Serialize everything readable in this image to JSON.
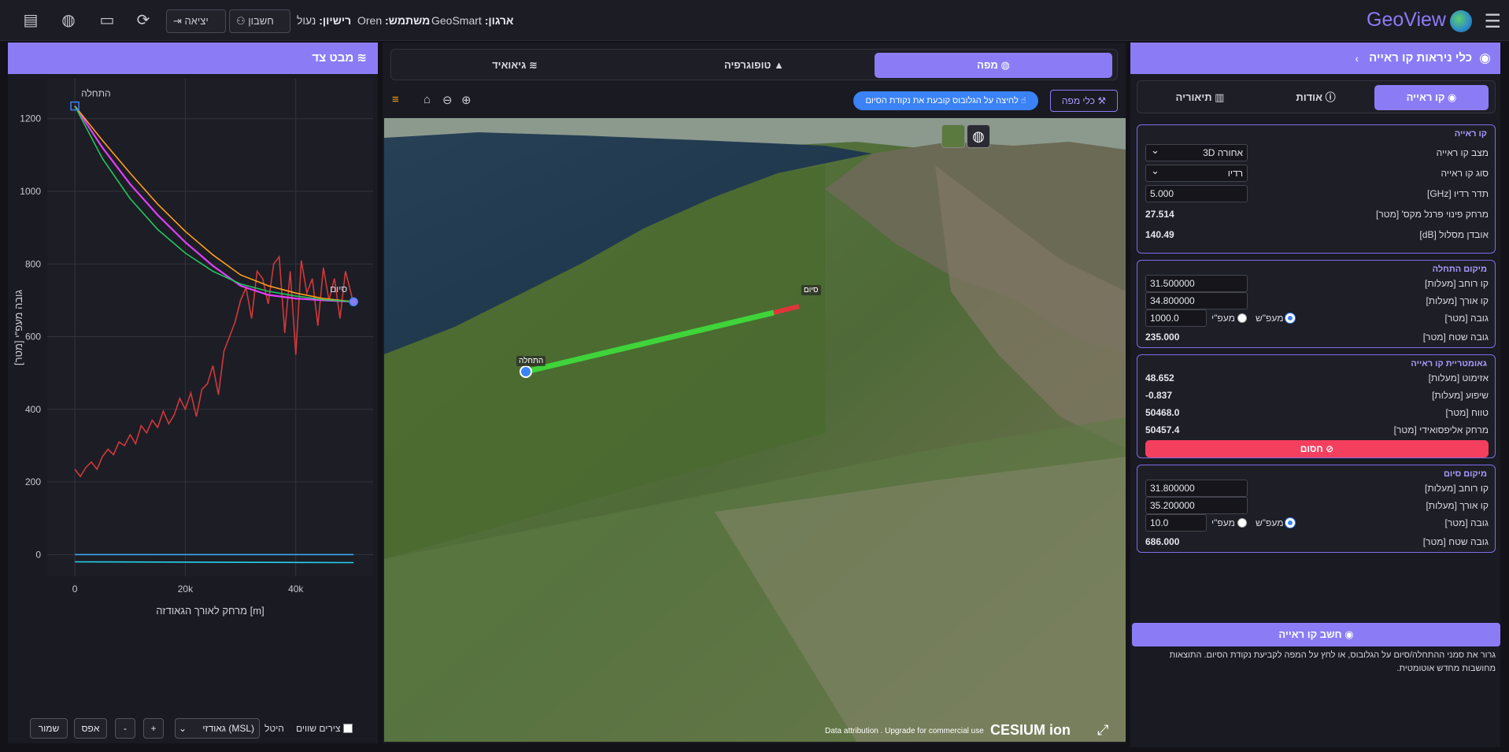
{
  "header": {
    "app_name": "GeoView",
    "org_label": "ארגון:",
    "org_value": "GeoSmart",
    "user_label": "משתמש:",
    "user_value": "Oren",
    "license_label": "רישיון:",
    "license_value": "נעול",
    "account_button": "חשבון",
    "logout_button": "יציאה",
    "icons": [
      "menu-icon",
      "globe-logo-icon",
      "chat-icon",
      "language-icon",
      "monitor-icon",
      "sync-icon",
      "account-icon",
      "logout-icon"
    ]
  },
  "right_panel": {
    "title": "כלי ניראות קו ראייה",
    "tabs": [
      {
        "label": "קו ראייה",
        "active": true
      },
      {
        "label": "אודות",
        "active": false
      },
      {
        "label": "תיאוריה",
        "active": false
      }
    ],
    "los": {
      "title": "קו ראייה",
      "mode_label": "מצב קו ראייה",
      "mode_value": "אחורה 3D",
      "type_label": "סוג קו ראייה",
      "type_value": "רדיו",
      "freq_label": "תדר רדיו [GHz]",
      "freq_value": "5.000",
      "fresnel_label": "מרחק פינוי פרנל מקס' [מטר]",
      "fresnel_value": "27.514",
      "loss_label": "אובדן מסלול [dB]",
      "loss_value": "140.49"
    },
    "start": {
      "title": "מיקום התחלה",
      "lat_label": "קו רוחב [מעלות]",
      "lat_value": "31.500000",
      "lon_label": "קו אורך [מעלות]",
      "lon_value": "34.800000",
      "height_label": "גובה [מטר]",
      "height_value": "1000.0",
      "radio_ground": "מעפ\"י",
      "radio_msl": "מעפ\"ש",
      "terrain_label": "גובה שטח [מטר]",
      "terrain_value": "235.000"
    },
    "geometry": {
      "title": "גאומטריית קו ראייה",
      "azimuth_label": "אזימוט [מעלות]",
      "azimuth_value": "48.652",
      "slope_label": "שיפוע [מעלות]",
      "slope_value": "-0.837",
      "range_label": "טווח [מטר]",
      "range_value": "50468.0",
      "ellipsoid_label": "מרחק אליפסואידי [מטר]",
      "ellipsoid_value": "50457.4",
      "blocked_button": "חסום"
    },
    "end": {
      "title": "מיקום סיום",
      "lat_label": "קו רוחב [מעלות]",
      "lat_value": "31.800000",
      "lon_label": "קו אורך [מעלות]",
      "lon_value": "35.200000",
      "height_label": "גובה [מטר]",
      "height_value": "10.0",
      "radio_ground": "מעפ\"י",
      "radio_msl": "מעפ\"ש",
      "terrain_label": "גובה שטח [מטר]",
      "terrain_value": "686.000"
    },
    "calc_button": "חשב קו ראייה",
    "note": "גרור את סמני ההתחלה/סיום על הגלובוס, או לחץ על המפה לקביעת נקודת הסיום. התוצאות מחושבות מחדש אוטומטית."
  },
  "center": {
    "tabs": [
      {
        "label": "מפה",
        "active": true
      },
      {
        "label": "טופוגרפיה",
        "active": false
      },
      {
        "label": "גיאואיד",
        "active": false
      }
    ],
    "hint": "לחיצה על הגלובוס קובעת את נקודת הסיום",
    "map_tools": "כלי מפה",
    "marker_start": "התחלה",
    "marker_end": "סיום",
    "credits": "Data attribution . Upgrade for commercial use",
    "cesium": "CESIUM ion"
  },
  "left_panel": {
    "title": "מבט צד",
    "save": "שמור",
    "reset": "אפס",
    "minus": "-",
    "plus": "+",
    "datum": "גאודזי (MSL)",
    "projection_label": "היטל",
    "equal_axes": "צירים שווים"
  },
  "chart_data": {
    "type": "line",
    "xlabel": "מרחק לאורך הגאודזה [m]",
    "ylabel": "גובה מעפ\"י [מטר]",
    "xlim": [
      -5000,
      54000
    ],
    "ylim": [
      -60,
      1310
    ],
    "x_ticks": [
      0,
      20000,
      40000
    ],
    "x_tick_labels": [
      "0",
      "20k",
      "40k"
    ],
    "y_ticks": [
      0,
      200,
      400,
      600,
      800,
      1000,
      1200
    ],
    "annotations": [
      {
        "text": "התחלה",
        "x": 0,
        "y": 1235
      },
      {
        "text": "סיום",
        "x": 50468,
        "y": 696
      }
    ],
    "series": [
      {
        "name": "terrain",
        "color": "#d0393b",
        "x": [
          0,
          1000,
          2000,
          3000,
          4000,
          5000,
          6000,
          7000,
          8000,
          9000,
          10000,
          11000,
          12000,
          13000,
          14000,
          15000,
          16000,
          17000,
          18000,
          19000,
          20000,
          21000,
          22000,
          23000,
          24000,
          25000,
          26000,
          27000,
          28000,
          29000,
          30000,
          31000,
          32000,
          33000,
          34000,
          35000,
          36000,
          37000,
          38000,
          39000,
          40000,
          41000,
          42000,
          43000,
          44000,
          45000,
          46000,
          47000,
          48000,
          49000,
          50000,
          50468
        ],
        "y": [
          235,
          215,
          240,
          255,
          235,
          270,
          290,
          275,
          310,
          300,
          330,
          305,
          355,
          335,
          370,
          350,
          395,
          360,
          385,
          430,
          400,
          445,
          380,
          455,
          470,
          520,
          440,
          560,
          600,
          640,
          700,
          735,
          650,
          780,
          760,
          690,
          800,
          820,
          610,
          780,
          550,
          810,
          720,
          760,
          630,
          790,
          700,
          760,
          650,
          780,
          720,
          686
        ]
      },
      {
        "name": "los",
        "color": "#e040fb",
        "x": [
          0,
          5000,
          10000,
          15000,
          20000,
          25000,
          30000,
          35000,
          40000,
          45000,
          50468
        ],
        "y": [
          1235,
          1120,
          1020,
          935,
          860,
          795,
          740,
          715,
          705,
          700,
          696
        ]
      },
      {
        "name": "fresnel-upper",
        "color": "#ff9f1c",
        "x": [
          0,
          5000,
          10000,
          15000,
          20000,
          25000,
          30000,
          35000,
          40000,
          45000,
          50468
        ],
        "y": [
          1235,
          1140,
          1050,
          965,
          890,
          825,
          770,
          740,
          720,
          705,
          696
        ]
      },
      {
        "name": "curvature",
        "color": "#22c55e",
        "x": [
          0,
          5000,
          10000,
          15000,
          20000,
          25000,
          30000,
          35000,
          40000,
          45000,
          50468
        ],
        "y": [
          1235,
          1090,
          980,
          895,
          830,
          780,
          745,
          725,
          712,
          702,
          696
        ]
      },
      {
        "name": "sea-level-1",
        "color": "#3ba7f0",
        "x": [
          0,
          50468
        ],
        "y": [
          0,
          0
        ]
      },
      {
        "name": "sea-level-2",
        "color": "#22d3ee",
        "x": [
          0,
          50468
        ],
        "y": [
          -20,
          -22
        ]
      }
    ]
  }
}
